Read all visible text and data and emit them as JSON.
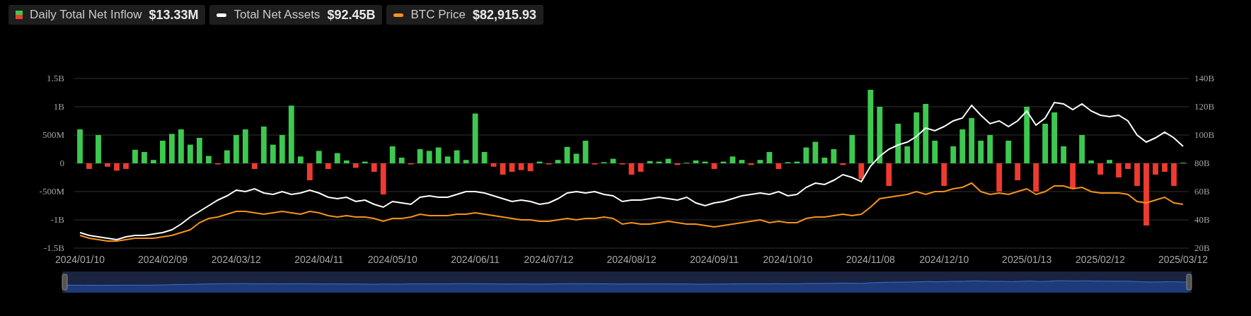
{
  "legend": [
    {
      "kind": "bar",
      "value": "$13.33M"
    },
    {
      "kind": "line",
      "value": "$92.45B"
    },
    {
      "kind": "line",
      "value": "$82,915.93"
    }
  ],
  "chart_data": {
    "type": "bar",
    "stacked": true,
    "grid": true,
    "ylim": [
      -1500000000.0,
      1500000000.0
    ],
    "y2lim": [
      20,
      140
    ],
    "yticks": [
      {
        "value": 1500000000.0,
        "label": "1.5B"
      },
      {
        "value": 1000000000.0,
        "label": "1B"
      },
      {
        "value": 500000000.0,
        "label": "500M"
      },
      {
        "value": 0,
        "label": "0"
      },
      {
        "value": -500000000.0,
        "label": "-500M"
      },
      {
        "value": -1000000000.0,
        "label": "-1B"
      },
      {
        "value": -1500000000.0,
        "label": "-1.5B"
      }
    ],
    "y2ticks": [
      {
        "value": 140,
        "label": "140B"
      },
      {
        "value": 120,
        "label": "120B"
      },
      {
        "value": 100,
        "label": "100B"
      },
      {
        "value": 80,
        "label": "80B"
      },
      {
        "value": 60,
        "label": "60B"
      },
      {
        "value": 40,
        "label": "40B"
      },
      {
        "value": 20,
        "label": "20B"
      }
    ],
    "categories": [
      "2024/01/10",
      null,
      null,
      null,
      null,
      null,
      null,
      null,
      null,
      "2024/02/09",
      null,
      null,
      null,
      null,
      null,
      null,
      null,
      "2024/03/12",
      null,
      null,
      null,
      null,
      null,
      null,
      null,
      null,
      "2024/04/11",
      null,
      null,
      null,
      null,
      null,
      null,
      null,
      "2024/05/10",
      null,
      null,
      null,
      null,
      null,
      null,
      null,
      null,
      "2024/06/11",
      null,
      null,
      null,
      null,
      null,
      null,
      null,
      "2024/07/12",
      null,
      null,
      null,
      null,
      null,
      null,
      null,
      null,
      "2024/08/12",
      null,
      null,
      null,
      null,
      null,
      null,
      null,
      null,
      "2024/09/11",
      null,
      null,
      null,
      null,
      null,
      null,
      null,
      "2024/10/10",
      null,
      null,
      null,
      null,
      null,
      null,
      null,
      null,
      "2024/11/08",
      null,
      null,
      null,
      null,
      null,
      null,
      null,
      "2024/12/10",
      null,
      null,
      null,
      null,
      null,
      null,
      null,
      null,
      "2025/01/13",
      null,
      null,
      null,
      null,
      null,
      null,
      null,
      "2025/02/12",
      null,
      null,
      null,
      null,
      null,
      null,
      null,
      null,
      "2025/03/12"
    ],
    "series": [
      {
        "name": "Daily Total Net Inflow",
        "type": "bar",
        "color": "#3dc94f",
        "values": [
          600000000.0,
          null,
          500000000.0,
          null,
          null,
          null,
          240000000.0,
          200000000.0,
          60000000.0,
          400000000.0,
          520000000.0,
          600000000.0,
          330000000.0,
          450000000.0,
          130000000.0,
          null,
          230000000.0,
          500000000.0,
          600000000.0,
          null,
          650000000.0,
          330000000.0,
          500000000.0,
          1020000000.0,
          120000000.0,
          null,
          220000000.0,
          null,
          180000000.0,
          50000000.0,
          null,
          30000000.0,
          null,
          null,
          300000000.0,
          100000000.0,
          null,
          250000000.0,
          220000000.0,
          280000000.0,
          120000000.0,
          230000000.0,
          60000000.0,
          880000000.0,
          200000000.0,
          null,
          null,
          null,
          null,
          null,
          30000000.0,
          null,
          60000000.0,
          290000000.0,
          170000000.0,
          400000000.0,
          null,
          20000000.0,
          80000000.0,
          null,
          null,
          null,
          40000000.0,
          30000000.0,
          80000000.0,
          null,
          10000000.0,
          50000000.0,
          30000000.0,
          null,
          30000000.0,
          120000000.0,
          60000000.0,
          null,
          60000000.0,
          200000000.0,
          null,
          20000000.0,
          30000000.0,
          280000000.0,
          380000000.0,
          100000000.0,
          250000000.0,
          null,
          500000000.0,
          null,
          1300000000.0,
          1000000000.0,
          null,
          700000000.0,
          300000000.0,
          900000000.0,
          1050000000.0,
          400000000.0,
          null,
          300000000.0,
          600000000.0,
          800000000.0,
          400000000.0,
          500000000.0,
          null,
          400000000.0,
          null,
          1000000000.0,
          null,
          700000000.0,
          900000000.0,
          300000000.0,
          null,
          500000000.0,
          50000000.0,
          null,
          60000000.0,
          null,
          null,
          null,
          null,
          null,
          null,
          null,
          10000000.0
        ]
      },
      {
        "type": "bar",
        "color": "#ef3b2f",
        "values": [
          null,
          -100000000.0,
          null,
          -60000000.0,
          -130000000.0,
          -100000000.0,
          null,
          null,
          null,
          null,
          null,
          null,
          null,
          null,
          null,
          -20000000.0,
          null,
          null,
          null,
          -100000000.0,
          null,
          null,
          null,
          null,
          null,
          -300000000.0,
          null,
          -100000000.0,
          null,
          null,
          -80000000.0,
          null,
          -150000000.0,
          -550000000.0,
          null,
          null,
          -20000000.0,
          null,
          null,
          null,
          null,
          null,
          null,
          null,
          null,
          -60000000.0,
          -200000000.0,
          -150000000.0,
          -120000000.0,
          -140000000.0,
          null,
          -20000000.0,
          null,
          null,
          null,
          null,
          -20000000.0,
          null,
          null,
          -20000000.0,
          -200000000.0,
          -150000000.0,
          null,
          null,
          null,
          -30000000.0,
          null,
          null,
          null,
          -100000000.0,
          null,
          null,
          null,
          -30000000.0,
          null,
          null,
          -100000000.0,
          null,
          null,
          null,
          null,
          null,
          null,
          -30000000.0,
          null,
          -280000000.0,
          null,
          null,
          -400000000.0,
          null,
          null,
          null,
          null,
          null,
          -400000000.0,
          null,
          null,
          null,
          null,
          null,
          -500000000.0,
          null,
          -300000000.0,
          null,
          -500000000.0,
          null,
          null,
          null,
          -450000000.0,
          null,
          null,
          -200000000.0,
          null,
          -250000000.0,
          -100000000.0,
          -400000000.0,
          -1100000000.0,
          -200000000.0,
          -150000000.0,
          -400000000.0,
          null
        ]
      },
      {
        "name": "Total Net Assets",
        "type": "line",
        "axis": "y2",
        "color": "#ffffff",
        "values": [
          31,
          29,
          28,
          27,
          26,
          28,
          29,
          29,
          30,
          31,
          33,
          37,
          42,
          46,
          50,
          54,
          57,
          61,
          60,
          62,
          59,
          58,
          60,
          58,
          59,
          61,
          59,
          56,
          55,
          56,
          53,
          54,
          51,
          49,
          53,
          52,
          51,
          56,
          57,
          56,
          56,
          58,
          60,
          60,
          59,
          57,
          55,
          53,
          54,
          53,
          51,
          52,
          55,
          59,
          60,
          59,
          60,
          58,
          57,
          53,
          54,
          54,
          55,
          56,
          55,
          54,
          56,
          52,
          50,
          52,
          53,
          55,
          57,
          58,
          59,
          58,
          60,
          57,
          58,
          63,
          66,
          65,
          68,
          72,
          70,
          67,
          78,
          85,
          90,
          93,
          95,
          99,
          105,
          103,
          106,
          110,
          112,
          121,
          114,
          108,
          110,
          106,
          110,
          117,
          107,
          112,
          123,
          122,
          118,
          122,
          117,
          114,
          113,
          114,
          110,
          100,
          95,
          98,
          102,
          98,
          92
        ]
      },
      {
        "name": "BTC Price",
        "type": "line",
        "axis": "y2",
        "color": "#f7931a",
        "values": [
          29,
          27,
          26,
          25,
          25,
          26,
          27,
          27,
          27,
          28,
          29,
          31,
          33,
          38,
          41,
          42,
          44,
          46,
          46,
          45,
          44,
          45,
          46,
          45,
          44,
          46,
          45,
          43,
          42,
          43,
          42,
          42,
          41,
          39,
          41,
          41,
          42,
          44,
          43,
          43,
          43,
          44,
          44,
          45,
          44,
          43,
          42,
          41,
          40,
          40,
          39,
          39,
          40,
          41,
          40,
          41,
          41,
          42,
          41,
          37,
          38,
          37,
          37,
          38,
          39,
          38,
          37,
          37,
          36,
          35,
          36,
          37,
          38,
          39,
          40,
          38,
          39,
          38,
          38,
          41,
          42,
          42,
          43,
          44,
          43,
          44,
          49,
          55,
          56,
          57,
          58,
          60,
          58,
          60,
          60,
          62,
          63,
          66,
          60,
          58,
          59,
          58,
          60,
          62,
          58,
          60,
          64,
          64,
          62,
          63,
          60,
          59,
          59,
          59,
          58,
          53,
          52,
          54,
          56,
          52,
          51
        ]
      }
    ]
  }
}
